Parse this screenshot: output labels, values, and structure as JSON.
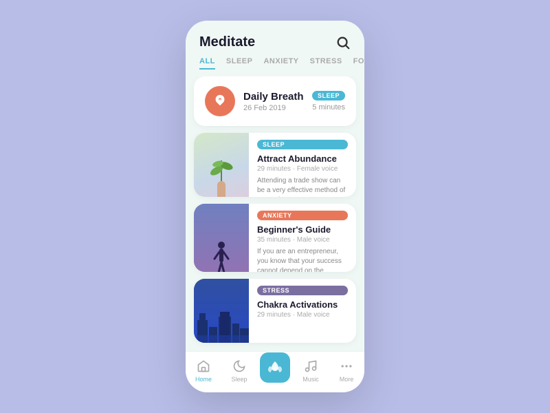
{
  "app": {
    "title": "Meditate",
    "background_color": "#b8bde8"
  },
  "tabs": [
    {
      "id": "all",
      "label": "ALL",
      "active": true
    },
    {
      "id": "sleep",
      "label": "SLEEP",
      "active": false
    },
    {
      "id": "anxiety",
      "label": "ANXIETY",
      "active": false
    },
    {
      "id": "stress",
      "label": "STRESS",
      "active": false
    },
    {
      "id": "focus",
      "label": "FOCUS",
      "active": false
    }
  ],
  "daily_card": {
    "title": "Daily Breath",
    "date": "26 Feb 2019",
    "badge": "SLEEP",
    "badge_type": "sleep",
    "duration": "5 minutes"
  },
  "content_cards": [
    {
      "id": "attract-abundance",
      "badge": "SLEEP",
      "badge_type": "sleep",
      "title": "Attract Abundance",
      "meta": "29 minutes · Female voice",
      "description": "Attending a trade show can be a very effective method of promoting your company.",
      "image_type": "hand"
    },
    {
      "id": "beginners-guide",
      "badge": "ANXIETY",
      "badge_type": "anxiety",
      "title": "Beginner's Guide",
      "meta": "35 minutes · Male voice",
      "description": "If you are an entrepreneur, you know that your success cannot depend on the opinions...",
      "image_type": "silhouette"
    },
    {
      "id": "chakra-activations",
      "badge": "STRESS",
      "badge_type": "stress",
      "title": "Chakra Activations",
      "meta": "29 minutes · Male voice",
      "description": "",
      "image_type": "city"
    }
  ],
  "nav": {
    "items": [
      {
        "id": "home",
        "label": "Home",
        "active": true,
        "icon": "home-icon"
      },
      {
        "id": "sleep",
        "label": "Sleep",
        "active": false,
        "icon": "moon-icon"
      },
      {
        "id": "meditate",
        "label": "",
        "active": false,
        "icon": "lotus-icon",
        "center": true
      },
      {
        "id": "music",
        "label": "Music",
        "active": false,
        "icon": "music-icon"
      },
      {
        "id": "more",
        "label": "More",
        "active": false,
        "icon": "more-icon"
      }
    ]
  }
}
